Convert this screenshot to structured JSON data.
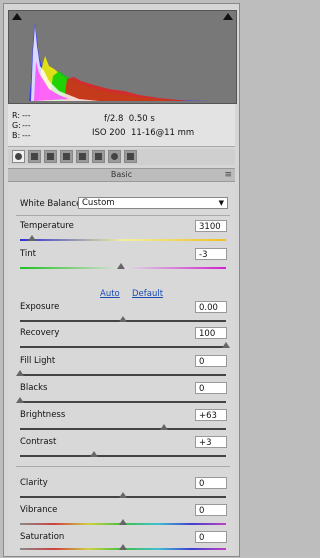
{
  "histogram": {
    "rgb": {
      "r_label": "R:",
      "r_value": "---",
      "g_label": "G:",
      "g_value": "---",
      "b_label": "B:",
      "b_value": "---"
    },
    "aperture": "f/2.8",
    "shutter": "0.50 s",
    "iso": "ISO 200",
    "lens": "11-16@11 mm"
  },
  "tab_header": {
    "title": "Basic",
    "menu_icon": "≡"
  },
  "white_balance": {
    "label": "White Balance:",
    "value": "Custom",
    "caret": "▼"
  },
  "links": {
    "auto": "Auto",
    "default": "Default"
  },
  "sliders": {
    "temperature": {
      "label": "Temperature",
      "value": "3100",
      "level": 0.06
    },
    "tint": {
      "label": "Tint",
      "value": "-3",
      "level": 0.49
    },
    "exposure": {
      "label": "Exposure",
      "value": "0.00",
      "level": 0.5
    },
    "recovery": {
      "label": "Recovery",
      "value": "100",
      "level": 1.0
    },
    "fill_light": {
      "label": "Fill Light",
      "value": "0",
      "level": 0.0
    },
    "blacks": {
      "label": "Blacks",
      "value": "0",
      "level": 0.0
    },
    "brightness": {
      "label": "Brightness",
      "value": "+63",
      "level": 0.7
    },
    "contrast": {
      "label": "Contrast",
      "value": "+3",
      "level": 0.36
    },
    "clarity": {
      "label": "Clarity",
      "value": "0",
      "level": 0.5
    },
    "vibrance": {
      "label": "Vibrance",
      "value": "0",
      "level": 0.5
    },
    "saturation": {
      "label": "Saturation",
      "value": "0",
      "level": 0.5
    }
  },
  "colors": {
    "panel_bg": "#d8d8d8",
    "histogram_bg": "#787878",
    "link": "#1a4db3"
  }
}
